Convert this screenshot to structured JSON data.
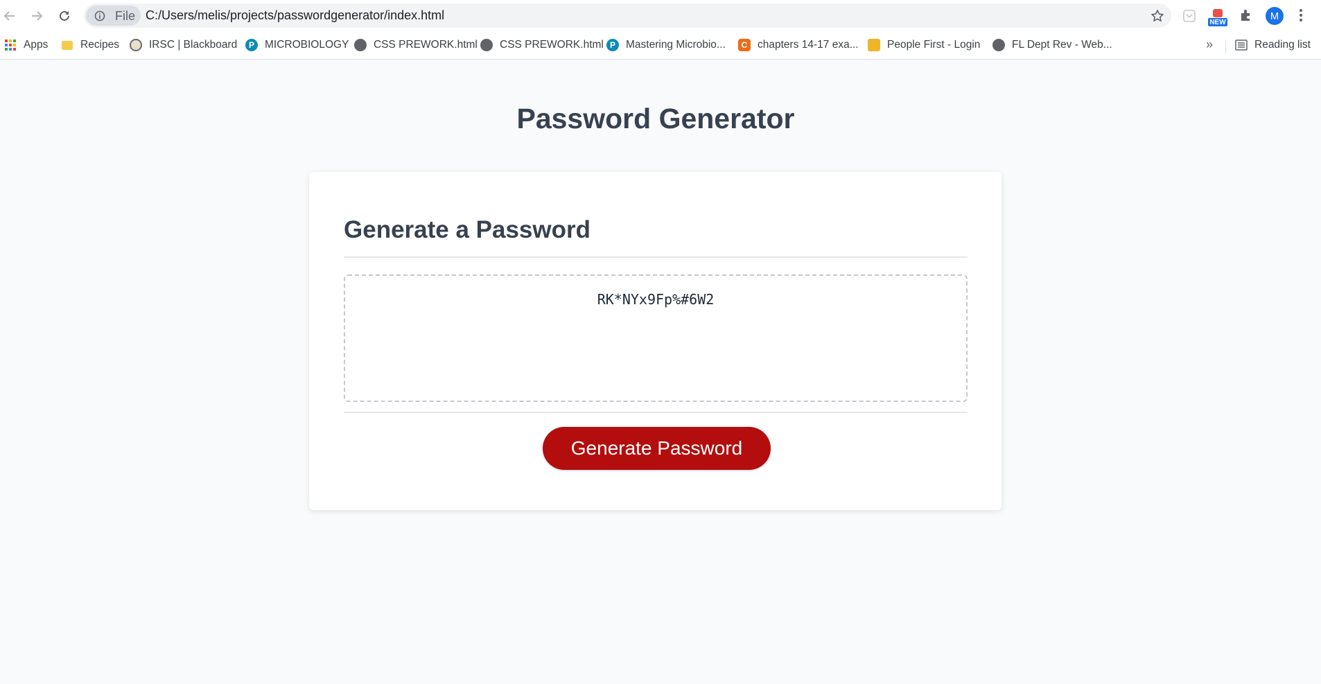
{
  "browser": {
    "chip_label": "File",
    "url": "C:/Users/melis/projects/passwordgenerator/index.html",
    "avatar_letter": "M",
    "new_badge": "NEW"
  },
  "bookmarks": {
    "items": [
      {
        "label": "Apps",
        "icon": "apps-grid-icon"
      },
      {
        "label": "Recipes",
        "icon": "folder-icon"
      },
      {
        "label": "IRSC | Blackboard",
        "icon": "irsc-logo-icon"
      },
      {
        "label": "MICROBIOLOGY",
        "icon": "pearson-icon"
      },
      {
        "label": "CSS PREWORK.html",
        "icon": "globe-icon"
      },
      {
        "label": "CSS PREWORK.html",
        "icon": "globe-icon"
      },
      {
        "label": "Mastering Microbio...",
        "icon": "pearson-icon"
      },
      {
        "label": "chapters 14-17 exa...",
        "icon": "chegg-icon"
      },
      {
        "label": "People First - Login",
        "icon": "people-first-icon"
      },
      {
        "label": "FL Dept Rev - Web...",
        "icon": "globe-icon"
      }
    ],
    "more": "»",
    "reading_list": "Reading list"
  },
  "page": {
    "title": "Password Generator",
    "card_title": "Generate a Password",
    "password": "RK*NYx9Fp%#6W2",
    "button_label": "Generate Password"
  },
  "colors": {
    "page_background": "#f9fafb",
    "heading": "#374151",
    "button": "#b30d0d"
  }
}
